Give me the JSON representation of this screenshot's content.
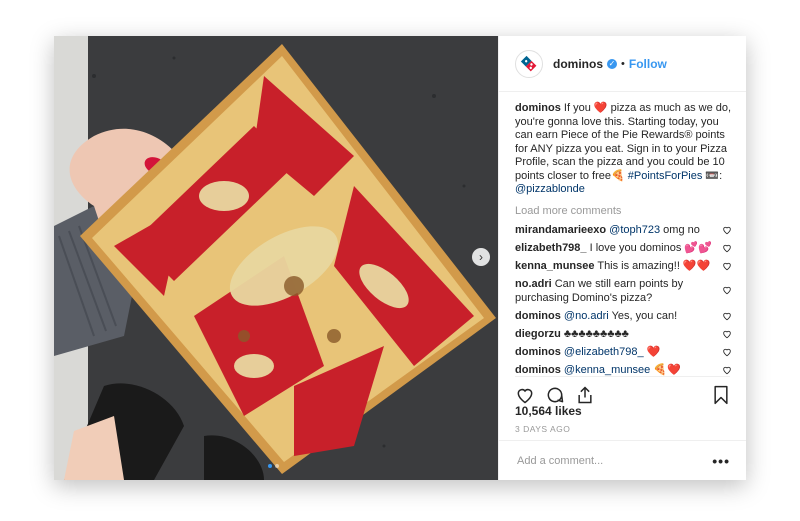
{
  "post": {
    "handle": "dominos",
    "separator": "•",
    "follow_label": "Follow",
    "caption": {
      "user": "dominos",
      "text": "If you ❤️ pizza as much as we do, you're gonna love this. Starting today, you can earn Piece of the Pie Rewards® points for ANY pizza you eat. Sign in to your Pizza Profile, scan the pizza and you could be 10 points closer to free🍕",
      "hashtag": "#PointsForPies",
      "emoji_tail": "📼:",
      "mention": "@pizzablonde"
    },
    "load_more_label": "Load more comments",
    "comments": [
      {
        "user": "mirandamarieexo",
        "mention": "@toph723",
        "text": " omg no"
      },
      {
        "user": "elizabeth798_",
        "mention": "",
        "text": "I love you dominos 💕💕"
      },
      {
        "user": "kenna_munsee",
        "mention": "",
        "text": "This is amazing!! ❤️❤️"
      },
      {
        "user": "no.adri",
        "mention": "",
        "text": "Can we still earn points by purchasing Domino's pizza?"
      },
      {
        "user": "dominos",
        "mention": "@no.adri",
        "text": " Yes, you can!"
      },
      {
        "user": "diegorzu",
        "mention": "",
        "text": "♣♣♣♣♣♣♣♣♣"
      },
      {
        "user": "dominos",
        "mention": "@elizabeth798_",
        "text": " ❤️"
      },
      {
        "user": "dominos",
        "mention": "@kenna_munsee",
        "text": " 🍕❤️"
      }
    ],
    "likes": "10,564 likes",
    "date": "3 DAYS AGO",
    "add_comment_placeholder": "Add a comment...",
    "more_options": "•••",
    "carousel_next": "›"
  },
  "colors": {
    "brand_blue": "#006491",
    "brand_red": "#e31837",
    "link_blue": "#3897f0",
    "heart_red": "#ed4956"
  },
  "icons": [
    "dominos-logo-icon",
    "verified-badge-icon",
    "like-icon",
    "comment-icon",
    "share-icon",
    "bookmark-icon",
    "comment-like-icon",
    "more-options-icon",
    "carousel-next-icon"
  ]
}
